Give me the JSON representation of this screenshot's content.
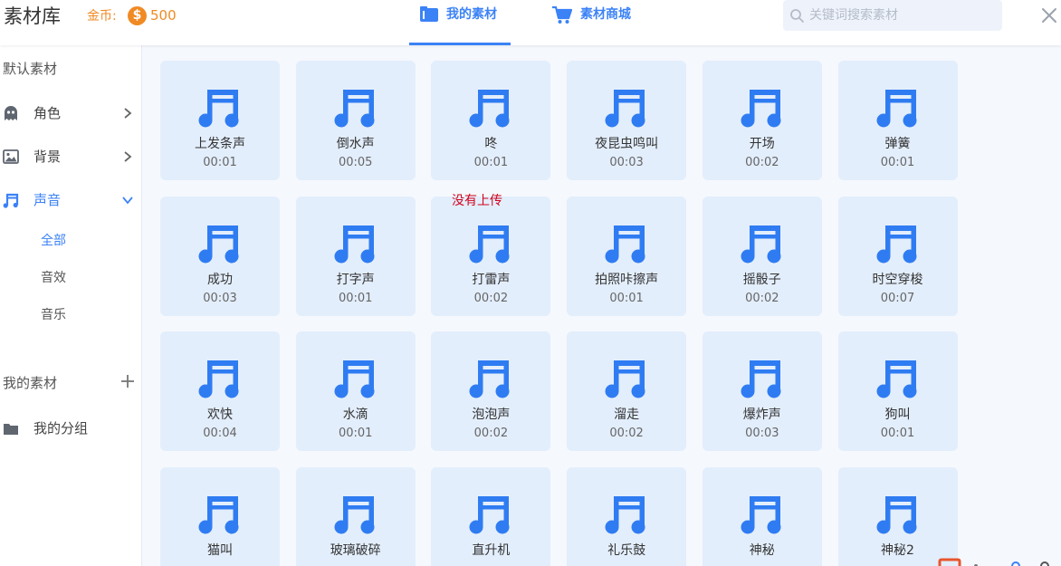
{
  "header": {
    "title": "素材库",
    "coin_label": "金币:",
    "coin_symbol": "$",
    "coin_amount": "500",
    "tabs": [
      {
        "label": "我的素材",
        "active": true
      },
      {
        "label": "素材商城",
        "active": false
      }
    ],
    "search_placeholder": "关键词搜索素材"
  },
  "sidebar": {
    "default_section": "默认素材",
    "categories": [
      {
        "label": "角色",
        "icon": "ghost-icon",
        "active": false
      },
      {
        "label": "背景",
        "icon": "image-icon",
        "active": false
      },
      {
        "label": "声音",
        "icon": "music-icon",
        "active": true
      }
    ],
    "sub_items": [
      {
        "label": "全部",
        "active": true
      },
      {
        "label": "音效",
        "active": false
      },
      {
        "label": "音乐",
        "active": false
      }
    ],
    "my_section": "我的素材",
    "my_group": "我的分组"
  },
  "main": {
    "overlay_note": "没有上传",
    "items": [
      {
        "name": "上发条声",
        "duration": "00:01"
      },
      {
        "name": "倒水声",
        "duration": "00:05"
      },
      {
        "name": "咚",
        "duration": "00:01"
      },
      {
        "name": "夜昆虫鸣叫",
        "duration": "00:03"
      },
      {
        "name": "开场",
        "duration": "00:02"
      },
      {
        "name": "弹簧",
        "duration": "00:01"
      },
      {
        "name": "成功",
        "duration": "00:03"
      },
      {
        "name": "打字声",
        "duration": "00:01"
      },
      {
        "name": "打雷声",
        "duration": "00:02"
      },
      {
        "name": "拍照咔擦声",
        "duration": "00:01"
      },
      {
        "name": "摇骰子",
        "duration": "00:02"
      },
      {
        "name": "时空穿梭",
        "duration": "00:07"
      },
      {
        "name": "欢快",
        "duration": "00:04"
      },
      {
        "name": "水滴",
        "duration": "00:01"
      },
      {
        "name": "泡泡声",
        "duration": "00:02"
      },
      {
        "name": "溜走",
        "duration": "00:02"
      },
      {
        "name": "爆炸声",
        "duration": "00:03"
      },
      {
        "name": "狗叫",
        "duration": "00:01"
      },
      {
        "name": "猫叫",
        "duration": ""
      },
      {
        "name": "玻璃破碎",
        "duration": ""
      },
      {
        "name": "直升机",
        "duration": ""
      },
      {
        "name": "礼乐鼓",
        "duration": ""
      },
      {
        "name": "神秘",
        "duration": ""
      },
      {
        "name": "神秘2",
        "duration": ""
      }
    ]
  },
  "colors": {
    "accent": "#3b82f6",
    "coin": "#f08a24",
    "card_bg": "#e3eefc",
    "warning_text": "#d0021b"
  }
}
